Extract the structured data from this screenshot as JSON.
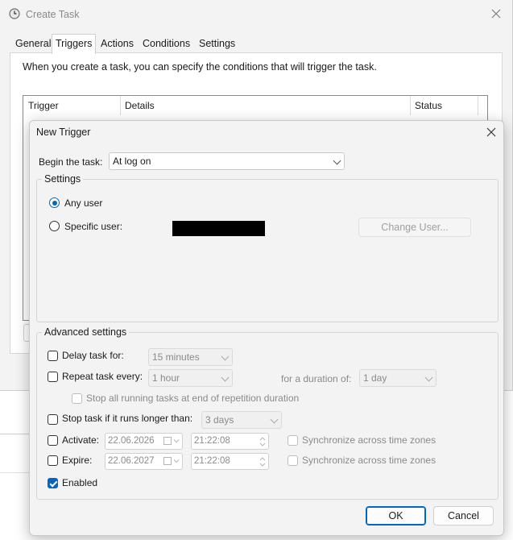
{
  "background_window": {
    "title": "Create Task",
    "tabs": [
      "General",
      "Triggers",
      "Actions",
      "Conditions",
      "Settings"
    ],
    "active_tab": "Triggers",
    "description": "When you create a task, you can specify the conditions that will trigger the task.",
    "table_columns": [
      "Trigger",
      "Details",
      "Status"
    ]
  },
  "dialog": {
    "title": "New Trigger",
    "begin_label": "Begin the task:",
    "begin_value": "At log on",
    "settings": {
      "title": "Settings",
      "any_user": "Any user",
      "specific_user": "Specific user:",
      "change_user": "Change User..."
    },
    "advanced": {
      "title": "Advanced settings",
      "delay": {
        "label": "Delay task for:",
        "value": "15 minutes"
      },
      "repeat": {
        "label": "Repeat task every:",
        "value": "1 hour",
        "duration_label": "for a duration of:",
        "duration_value": "1 day"
      },
      "stop_running": "Stop all running tasks at end of repetition duration",
      "stop_longer": {
        "label": "Stop task if it runs longer than:",
        "value": "3 days"
      },
      "activate": {
        "label": "Activate:",
        "date": "22.06.2026",
        "time": "21:22:08",
        "sync": "Synchronize across time zones"
      },
      "expire": {
        "label": "Expire:",
        "date": "22.06.2027",
        "time": "21:22:08",
        "sync": "Synchronize across time zones"
      },
      "enabled": "Enabled"
    },
    "ok": "OK",
    "cancel": "Cancel"
  },
  "colors": {
    "accent": "#0067c0"
  }
}
